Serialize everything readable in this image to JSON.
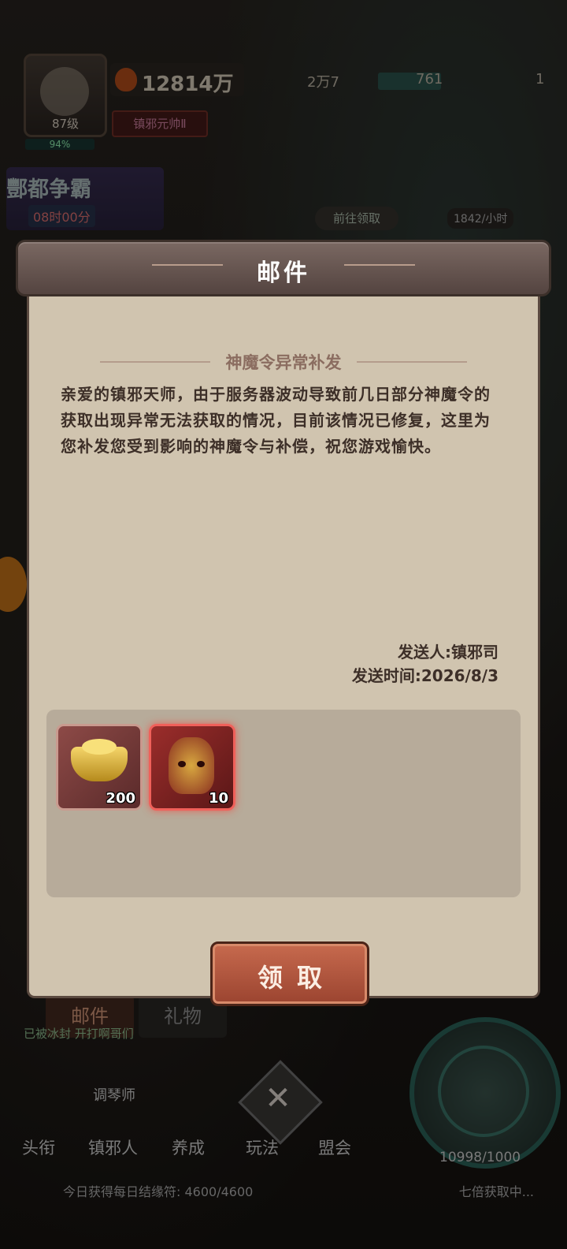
{
  "hud": {
    "level": "87级",
    "hp_percent": "94%",
    "power": "12814万",
    "rank": "镇邪元帅Ⅱ",
    "res_a": "2万7",
    "res_b": "761",
    "res_c": "1",
    "event_title": "酆都争霸",
    "event_time": "08时00分",
    "go_claim": "前往领取",
    "rate": "1842/小时"
  },
  "mail": {
    "title": "邮件",
    "subject": "神魔令异常补发",
    "body": "亲爱的镇邪天师，由于服务器波动导致前几日部分神魔令的获取出现异常无法获取的情况，目前该情况已修复，这里为您补发您受到影响的神魔令与补偿，祝您游戏愉快。",
    "sender": "发送人:镇邪司",
    "send_time": "发送时间:2026/8/3",
    "attachments": [
      {
        "name": "gold-ingot",
        "qty": "200"
      },
      {
        "name": "demon-token",
        "qty": "10"
      }
    ],
    "claim_label": "领取"
  },
  "bottom": {
    "tab_mail": "邮件",
    "tab_gift": "礼物",
    "chat": "已被冰封 开打啊哥们",
    "nav_tuner": "调琴师",
    "nav": [
      "头衔",
      "镇邪人",
      "养成",
      "玩法",
      "盟会"
    ],
    "coin_count": "10998/1000",
    "footer_left": "今日获得每日结缘符: 4600/4600",
    "footer_right": "七倍获取中..."
  },
  "colors": {
    "panel": "#d0c4af",
    "title_bar": "#6a5852",
    "button": "#b5573c",
    "attach_bg": "#b7ab9a"
  }
}
